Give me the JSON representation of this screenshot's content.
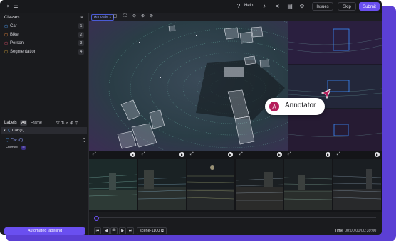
{
  "topbar": {
    "help": "Help",
    "issues": "Issues",
    "skip": "Skip",
    "submit": "Submit"
  },
  "classes": {
    "title": "Classes",
    "items": [
      {
        "label": "Car",
        "count": "1",
        "color": "#4fa3ff"
      },
      {
        "label": "Bike",
        "count": "2",
        "color": "#f08a3c"
      },
      {
        "label": "Person",
        "count": "3",
        "color": "#e0506a"
      },
      {
        "label": "Segmentation",
        "count": "4",
        "color": "#d4a23a"
      }
    ]
  },
  "labels": {
    "title": "Labels",
    "tabs": [
      "All",
      "Frame"
    ],
    "group": "Car (1)",
    "item": "Car (0)",
    "item_key": "Q",
    "frames_label": "Frames",
    "frames_value": "0"
  },
  "automated_button": "Automated labelling",
  "toolbar": {
    "annotate_chip": "Annotate 1"
  },
  "callout": {
    "avatar": "A",
    "text": "Annotator"
  },
  "timeline": {
    "scene": "scene-1100",
    "time_label": "Time",
    "time_value": "00:00:00/00:39:00"
  },
  "colors": {
    "accent": "#6a4ff0",
    "cuboid_3d": "#c9cdd6",
    "box_2d": "#3a8bff"
  }
}
